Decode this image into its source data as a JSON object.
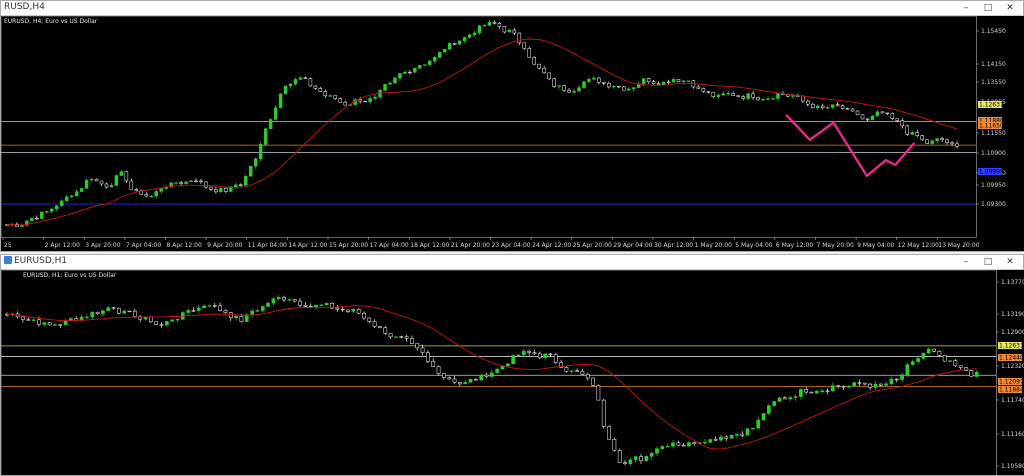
{
  "colors": {
    "bull": "#32c832",
    "bear": "#ffffff",
    "ma": "#c81414",
    "resistance": "#d6d640",
    "support_orange": "#e0803a",
    "support_white": "#cfcfcf",
    "blue_level": "#2030e0",
    "pattern": "#e8288c",
    "label_yellow": "#e8e85a",
    "label_orange": "#f08a3a",
    "label_blue": "#3040ff"
  },
  "windows": [
    {
      "id": "h4",
      "title": "RUSD,H4",
      "chart_label": "EURUSD, H4:  Euro vs US Dollar",
      "price_ticks": [
        "1.15450",
        "1.14150",
        "1.13550",
        "1.12855",
        "1.11550",
        "1.10900",
        "1.10250",
        "1.09950",
        "1.09300"
      ],
      "time_ticks": [
        "25",
        "2 Apr 12:00",
        "3 Apr 20:00",
        "7 Apr 04:00",
        "8 Apr 12:00",
        "9 Apr 20:00",
        "11 Apr 04:00",
        "14 Apr 12:00",
        "15 Apr 20:00",
        "17 Apr 04:00",
        "18 Apr 12:00",
        "21 Apr 20:00",
        "23 Apr 04:00",
        "24 Apr 12:00",
        "25 Apr 20:00",
        "29 Apr 04:00",
        "30 Apr 12:00",
        "1 May 20:00",
        "5 May 04:00",
        "6 May 12:00",
        "7 May 20:00",
        "9 May 04:00",
        "12 May 12:00",
        "13 May 20:00"
      ],
      "level_labels": [
        "1.12631",
        "1.11880",
        "1.11650",
        "1.09999"
      ],
      "chart_data": {
        "type": "candlestick",
        "series": [
          {
            "values": [
              1.0935,
              1.0955,
              1.0975,
              1.1005,
              1.104,
              1.1085,
              1.106,
              1.1095,
              1.1035,
              1.1025,
              1.106,
              1.107,
              1.108,
              1.105,
              1.1045,
              1.1065,
              1.114,
              1.1275,
              1.1385,
              1.14,
              1.137,
              1.134,
              1.132,
              1.1335,
              1.1335,
              1.138,
              1.142,
              1.1445,
              1.1465,
              1.1505,
              1.153,
              1.156,
              1.1575,
              1.155,
              1.1505,
              1.143,
              1.138,
              1.1365,
              1.139,
              1.1395,
              1.138,
              1.137,
              1.1395,
              1.139,
              1.14,
              1.1395,
              1.136,
              1.134,
              1.135,
              1.1345,
              1.134,
              1.135,
              1.1345,
              1.132,
              1.1305,
              1.131,
              1.129,
              1.1265,
              1.129,
              1.126,
              1.122,
              1.1195,
              1.1205,
              1.118
            ]
          }
        ]
      }
    },
    {
      "id": "h1",
      "title": "EURUSD,H1",
      "chart_label": "EURUSD, H1:  Euro vs US Dollar",
      "price_ticks": [
        "1.13770",
        "1.13190",
        "1.12900",
        "1.12320",
        "1.11740",
        "1.11160",
        "1.10580"
      ],
      "level_labels": [
        "1.12631",
        "1.12440",
        "1.12097",
        "1.11884"
      ],
      "chart_data": {
        "type": "candlestick",
        "series": [
          {
            "values": [
              1.132,
              1.131,
              1.13,
              1.1305,
              1.1315,
              1.1325,
              1.1335,
              1.132,
              1.131,
              1.13,
              1.1315,
              1.133,
              1.134,
              1.1325,
              1.131,
              1.133,
              1.1345,
              1.135,
              1.134,
              1.1335,
              1.133,
              1.1325,
              1.131,
              1.129,
              1.1275,
              1.1255,
              1.1225,
              1.1205,
              1.1195,
              1.1205,
              1.122,
              1.124,
              1.125,
              1.1245,
              1.123,
              1.1215,
              1.1195,
              1.11,
              1.105,
              1.106,
              1.108,
              1.109,
              1.1085,
              1.1095,
              1.11,
              1.1105,
              1.1115,
              1.115,
              1.117,
              1.118,
              1.1185,
              1.119,
              1.119,
              1.1195,
              1.119,
              1.12,
              1.123,
              1.1255,
              1.1235,
              1.122,
              1.121
            ]
          }
        ]
      }
    }
  ]
}
